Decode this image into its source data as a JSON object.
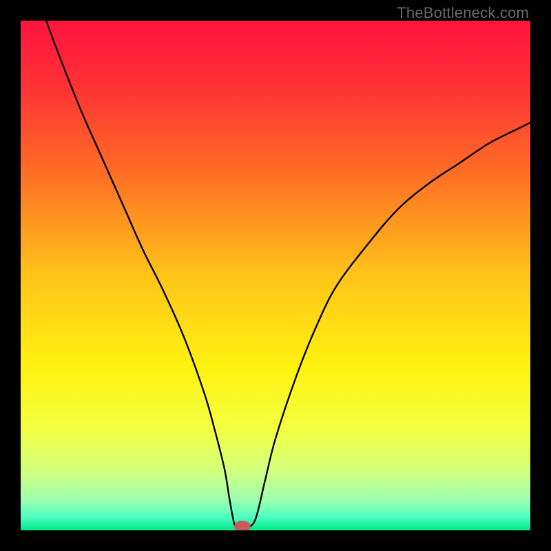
{
  "watermark": "TheBottleneck.com",
  "chart_data": {
    "type": "line",
    "title": "",
    "xlabel": "",
    "ylabel": "",
    "xlim": [
      0,
      100
    ],
    "ylim": [
      0,
      100
    ],
    "gradient_stops": [
      {
        "offset": 0.0,
        "color": "#ff143f"
      },
      {
        "offset": 0.12,
        "color": "#ff2f36"
      },
      {
        "offset": 0.3,
        "color": "#ff6e25"
      },
      {
        "offset": 0.5,
        "color": "#ffc419"
      },
      {
        "offset": 0.68,
        "color": "#fff210"
      },
      {
        "offset": 0.8,
        "color": "#f3ff40"
      },
      {
        "offset": 0.88,
        "color": "#d4ff7a"
      },
      {
        "offset": 0.94,
        "color": "#9dffb0"
      },
      {
        "offset": 0.975,
        "color": "#4bffc4"
      },
      {
        "offset": 1.0,
        "color": "#00e887"
      }
    ],
    "series": [
      {
        "name": "bottleneck-curve",
        "x": [
          5,
          8,
          12,
          16,
          20,
          24,
          28,
          32,
          36,
          38,
          40,
          41,
          42,
          43,
          44,
          46,
          48,
          50,
          54,
          58,
          62,
          68,
          74,
          80,
          86,
          92,
          98,
          100
        ],
        "y": [
          100,
          92,
          82,
          73,
          64,
          55,
          47,
          38,
          27,
          20,
          12,
          6,
          1,
          0.5,
          0.5,
          2,
          10,
          18,
          30,
          40,
          48,
          56,
          63,
          68,
          72,
          76,
          79,
          80
        ]
      }
    ],
    "marker": {
      "x": 43.5,
      "y": 0.8,
      "rx": 1.6,
      "ry": 1.1,
      "fill": "#c95a5a"
    }
  }
}
